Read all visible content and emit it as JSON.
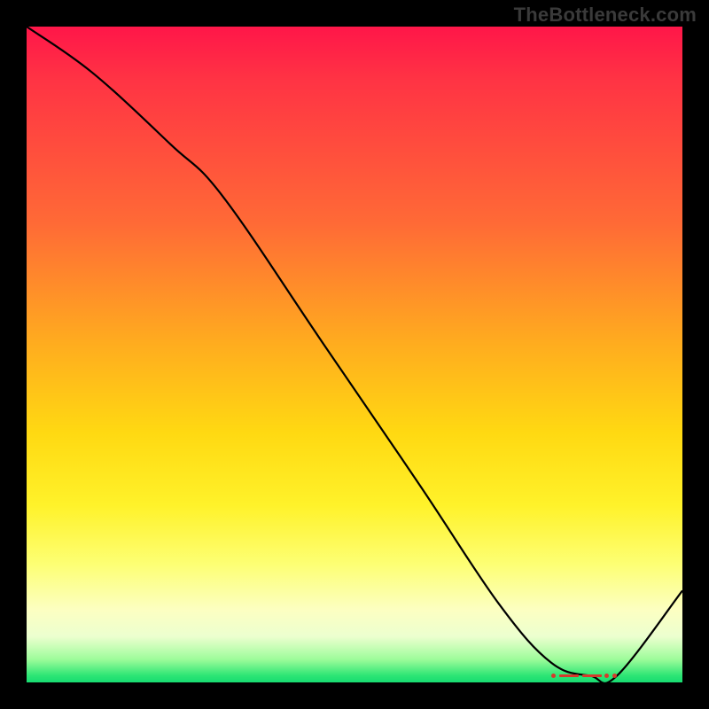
{
  "watermark": "TheBottleneck.com",
  "chart_data": {
    "type": "line",
    "title": "",
    "xlabel": "",
    "ylabel": "",
    "xlim": [
      0,
      100
    ],
    "ylim": [
      0,
      100
    ],
    "grid": false,
    "legend": false,
    "series": [
      {
        "name": "curve",
        "x": [
          0,
          10,
          22,
          30,
          45,
          60,
          72,
          80,
          86,
          90,
          100
        ],
        "y": [
          100,
          93,
          82,
          74,
          52,
          30,
          12,
          3,
          1,
          1,
          14
        ]
      }
    ],
    "marker_band": {
      "x_start": 80,
      "x_end": 90,
      "y": 1
    },
    "background_gradient": {
      "stops": [
        {
          "pos": 0,
          "color": "#ff1649"
        },
        {
          "pos": 30,
          "color": "#ff6a36"
        },
        {
          "pos": 62,
          "color": "#ffd912"
        },
        {
          "pos": 89,
          "color": "#fcffc2"
        },
        {
          "pos": 100,
          "color": "#18db71"
        }
      ]
    }
  }
}
